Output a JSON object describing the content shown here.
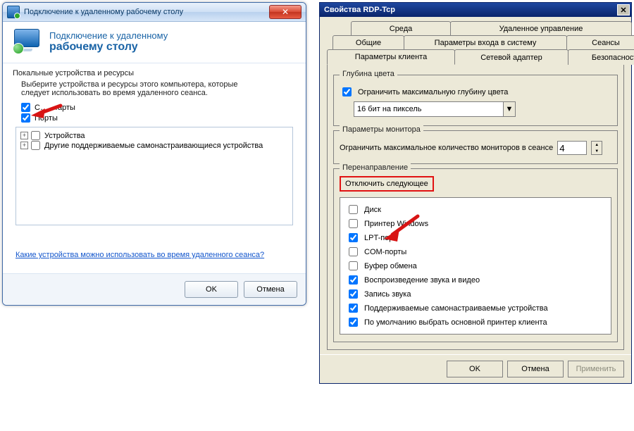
{
  "left": {
    "title": "Подключение к удаленному рабочему столу",
    "header_line1": "Подключение к удаленному",
    "header_line2": "рабочему столу",
    "section_title": "Покальные устройства и ресурсы",
    "instruction": "Выберите устройства и ресурсы этого компьютера, которые следует использовать во время удаленного сеанса.",
    "check_smart": {
      "label": "С…  …арты",
      "checked": true
    },
    "check_ports": {
      "label": "Порты",
      "checked": true
    },
    "tree": {
      "item1": "Устройства",
      "item2": "Другие поддерживаемые самонастраивающиеся устройства"
    },
    "link": "Какие устройства можно использовать во время удаленного сеанса?",
    "btn_ok": "OK",
    "btn_cancel": "Отмена"
  },
  "right": {
    "title": "Свойства RDP-Tcp",
    "tabs_r1": {
      "t1": "Среда",
      "t2": "Удаленное управление"
    },
    "tabs_r2": {
      "t1": "Общие",
      "t2": "Параметры входа в систему",
      "t3": "Сеансы"
    },
    "tabs_r3": {
      "t1": "Параметры клиента",
      "t2": "Сетевой адаптер",
      "t3": "Безопасность"
    },
    "grp_color": {
      "legend": "Глубина цвета",
      "check_limit": {
        "label": "Ограничить максимальную глубину цвета",
        "checked": true
      },
      "combo_value": "16 бит на пиксель"
    },
    "grp_mon": {
      "legend": "Параметры монитора",
      "label": "Ограничить максимальное количество мониторов в сеансе",
      "value": "4"
    },
    "grp_redir": {
      "legend": "Перенаправление",
      "subtitle": "Отключить следующее",
      "items": [
        {
          "label": "Диск",
          "checked": false
        },
        {
          "label": "Принтер Windows",
          "checked": false
        },
        {
          "label": "LPT-порт",
          "checked": true
        },
        {
          "label": "COM-порты",
          "checked": false
        },
        {
          "label": "Буфер обмена",
          "checked": false
        },
        {
          "label": "Воспроизведение звука и видео",
          "checked": true
        },
        {
          "label": "Запись звука",
          "checked": true
        },
        {
          "label": "Поддерживаемые самонастраиваемые устройства",
          "checked": true
        },
        {
          "label": "По умолчанию выбрать основной принтер клиента",
          "checked": true
        }
      ]
    },
    "btn_ok": "OK",
    "btn_cancel": "Отмена",
    "btn_apply": "Применить"
  }
}
